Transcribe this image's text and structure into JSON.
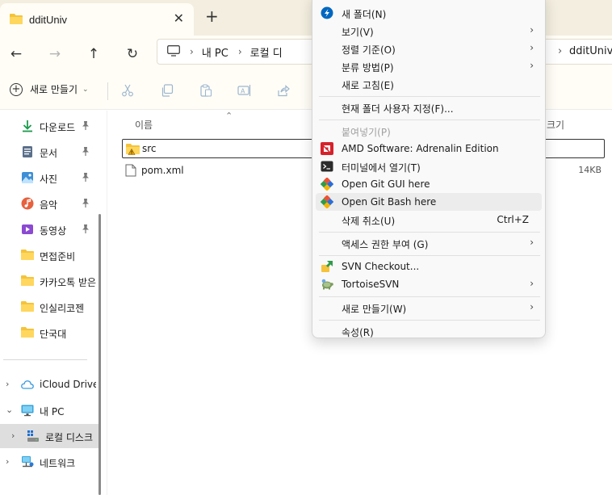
{
  "window": {
    "tab_title": "dditUniv",
    "tab_close_glyph": "✕",
    "new_tab_glyph": "+"
  },
  "nav": {
    "back_glyph": "←",
    "forward_glyph": "→",
    "up_glyph": "↑",
    "refresh_glyph": "↻",
    "breadcrumb": [
      "내 PC",
      "로컬 디",
      "dditUniv"
    ],
    "sep_glyph": "›"
  },
  "toolbar": {
    "new_label": "새로 만들기",
    "new_caret": "⌄",
    "icons": [
      "cut-icon",
      "copy-icon",
      "paste-icon",
      "rename-icon",
      "share-icon"
    ]
  },
  "sidebar": {
    "quick_access": [
      {
        "label": "다운로드",
        "icon": "download-icon",
        "pinned": true
      },
      {
        "label": "문서",
        "icon": "documents-icon",
        "pinned": true
      },
      {
        "label": "사진",
        "icon": "pictures-icon",
        "pinned": true
      },
      {
        "label": "음악",
        "icon": "music-icon",
        "pinned": true
      },
      {
        "label": "동영상",
        "icon": "videos-icon",
        "pinned": true
      },
      {
        "label": "면접준비",
        "icon": "folder-icon",
        "pinned": false
      },
      {
        "label": "카카오톡 받은",
        "icon": "folder-icon",
        "pinned": false
      },
      {
        "label": "인실리코젠",
        "icon": "folder-icon",
        "pinned": false
      },
      {
        "label": "단국대",
        "icon": "folder-icon",
        "pinned": false
      }
    ],
    "tree": [
      {
        "label": "iCloud Drive",
        "icon": "icloud-icon",
        "chevron": "›"
      },
      {
        "label": "내 PC",
        "icon": "pc-icon",
        "chevron": "⌄"
      },
      {
        "label": "로컬 디스크",
        "icon": "drive-icon",
        "chevron": "›"
      },
      {
        "label": "네트워크",
        "icon": "network-icon",
        "chevron": "›"
      }
    ],
    "pin_glyph": "📌"
  },
  "files": {
    "col_name": "이름",
    "col_size": "크기",
    "sort_glyph": "⌃",
    "rows": [
      {
        "name": "src",
        "icon": "folder-warning-icon",
        "size": ""
      },
      {
        "name": "pom.xml",
        "icon": "file-icon",
        "size": "14KB"
      }
    ]
  },
  "context_menu": {
    "items": [
      {
        "label": "새 폴더(N)",
        "icon": "new-folder-icon",
        "sub": false,
        "shortcut": "",
        "disabled": false
      },
      {
        "label": "보기(V)",
        "icon": "",
        "sub": true,
        "shortcut": "",
        "disabled": false
      },
      {
        "label": "정렬 기준(O)",
        "icon": "",
        "sub": true,
        "shortcut": "",
        "disabled": false
      },
      {
        "label": "분류 방법(P)",
        "icon": "",
        "sub": true,
        "shortcut": "",
        "disabled": false
      },
      {
        "label": "새로 고침(E)",
        "icon": "",
        "sub": false,
        "shortcut": "",
        "disabled": false
      },
      {
        "label": "현재 폴더 사용자 지정(F)...",
        "icon": "",
        "sub": false,
        "shortcut": "",
        "disabled": false
      },
      {
        "label": "붙여넣기(P)",
        "icon": "",
        "sub": false,
        "shortcut": "",
        "disabled": true
      },
      {
        "label": "AMD Software: Adrenalin Edition",
        "icon": "amd-icon",
        "sub": false,
        "shortcut": "",
        "disabled": false
      },
      {
        "label": "터미널에서 열기(T)",
        "icon": "terminal-icon",
        "sub": false,
        "shortcut": "",
        "disabled": false
      },
      {
        "label": "Open Git GUI here",
        "icon": "git-gui-icon",
        "sub": false,
        "shortcut": "",
        "disabled": false
      },
      {
        "label": "Open Git Bash here",
        "icon": "git-bash-icon",
        "sub": false,
        "shortcut": "",
        "disabled": false
      },
      {
        "label": "삭제 취소(U)",
        "icon": "",
        "sub": false,
        "shortcut": "Ctrl+Z",
        "disabled": false
      },
      {
        "label": "액세스 권한 부여 (G)",
        "icon": "",
        "sub": true,
        "shortcut": "",
        "disabled": false
      },
      {
        "label": "SVN Checkout...",
        "icon": "svn-checkout-icon",
        "sub": false,
        "shortcut": "",
        "disabled": false
      },
      {
        "label": "TortoiseSVN",
        "icon": "tortoisesvn-icon",
        "sub": true,
        "shortcut": "",
        "disabled": false
      },
      {
        "label": "새로 만들기(W)",
        "icon": "",
        "sub": true,
        "shortcut": "",
        "disabled": false
      },
      {
        "label": "속성(R)",
        "icon": "",
        "sub": false,
        "shortcut": "",
        "disabled": false
      }
    ],
    "sub_glyph": "›"
  },
  "colors": {
    "accent": "#0067c0",
    "folder": "#f5c33b",
    "amd": "#d6222b",
    "git": "#f05133"
  }
}
